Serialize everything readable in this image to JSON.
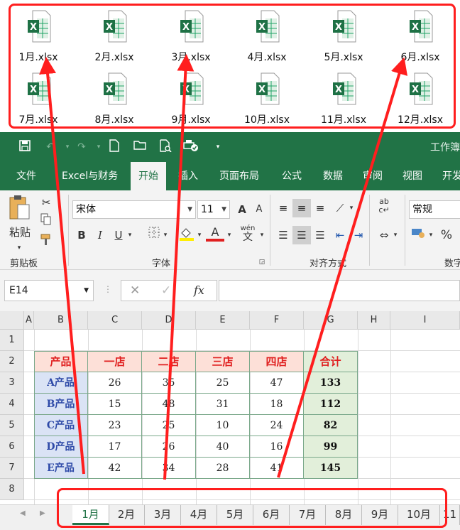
{
  "files": [
    {
      "name": "1月.xlsx"
    },
    {
      "name": "2月.xlsx"
    },
    {
      "name": "3月.xlsx"
    },
    {
      "name": "4月.xlsx"
    },
    {
      "name": "5月.xlsx"
    },
    {
      "name": "6月.xlsx"
    },
    {
      "name": "7月.xlsx"
    },
    {
      "name": "8月.xlsx"
    },
    {
      "name": "9月.xlsx"
    },
    {
      "name": "10月.xlsx"
    },
    {
      "name": "11月.xlsx"
    },
    {
      "name": "12月.xlsx"
    }
  ],
  "file_icon_letter": "X",
  "app_title": "工作簿",
  "tabs": [
    "文件",
    "Excel与财务",
    "开始",
    "插入",
    "页面布局",
    "公式",
    "数据",
    "审阅",
    "视图",
    "开发"
  ],
  "active_tab": "开始",
  "ribbon": {
    "paste_label": "粘贴",
    "clipboard_label": "剪贴板",
    "font_name": "宋体",
    "font_size": "11",
    "font_group_label": "字体",
    "align_group_label": "对齐方式",
    "number_format": "常规",
    "number_group_label": "数字",
    "bold": "B",
    "italic": "I",
    "underline": "U",
    "grow_font": "A",
    "shrink_font": "A",
    "font_color": "A",
    "phonetic": "wén",
    "percent": "%"
  },
  "formula_bar": {
    "name_box": "E14",
    "fx": "fx"
  },
  "columns": [
    "A",
    "B",
    "C",
    "D",
    "E",
    "F",
    "G",
    "H",
    "I"
  ],
  "rows": [
    "1",
    "2",
    "3",
    "4",
    "5",
    "6",
    "7",
    "8"
  ],
  "table": {
    "headers": [
      "产品",
      "一店",
      "二店",
      "三店",
      "四店",
      "合计"
    ],
    "rows": [
      [
        "A产品",
        "26",
        "35",
        "25",
        "47",
        "133"
      ],
      [
        "B产品",
        "15",
        "48",
        "31",
        "18",
        "112"
      ],
      [
        "C产品",
        "23",
        "25",
        "10",
        "24",
        "82"
      ],
      [
        "D产品",
        "17",
        "26",
        "40",
        "16",
        "99"
      ],
      [
        "E产品",
        "42",
        "34",
        "28",
        "41",
        "145"
      ]
    ]
  },
  "sheets": [
    "1月",
    "2月",
    "3月",
    "4月",
    "5月",
    "6月",
    "7月",
    "8月",
    "9月",
    "10月",
    "11"
  ],
  "active_sheet": "1月",
  "colors": {
    "excel_green": "#217346",
    "highlight_red": "#ff1e1e",
    "header_fill": "#fde0d8",
    "label_fill": "#dae3f5",
    "total_fill": "#e2efda"
  }
}
